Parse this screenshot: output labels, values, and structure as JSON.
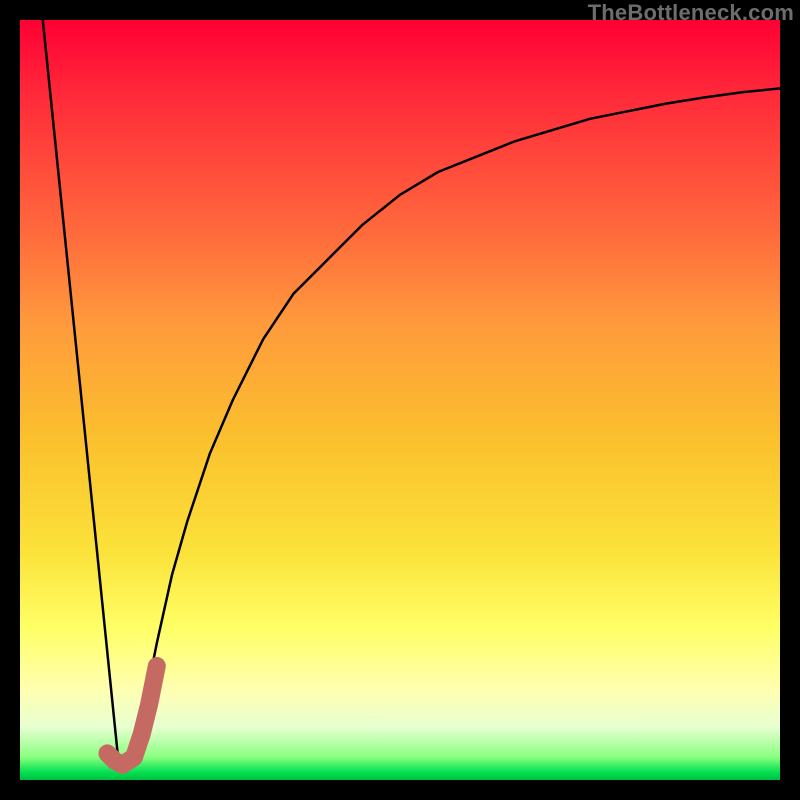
{
  "watermark": "TheBottleneck.com",
  "colors": {
    "frame": "#000000",
    "curve_stroke": "#000000",
    "marker_stroke": "#c56a63",
    "gradient_top": "#ff0033",
    "gradient_bottom": "#00c040"
  },
  "chart_data": {
    "type": "line",
    "title": "",
    "xlabel": "",
    "ylabel": "",
    "xlim": [
      0,
      100
    ],
    "ylim": [
      0,
      100
    ],
    "grid": false,
    "legend": false,
    "series": [
      {
        "name": "left-line",
        "kind": "line",
        "x": [
          3,
          13
        ],
        "y": [
          100,
          2
        ]
      },
      {
        "name": "right-curve",
        "kind": "line",
        "x": [
          15,
          16,
          18,
          20,
          22,
          25,
          28,
          32,
          36,
          40,
          45,
          50,
          55,
          60,
          65,
          70,
          75,
          80,
          85,
          90,
          95,
          100
        ],
        "y": [
          2,
          8,
          18,
          27,
          34,
          43,
          50,
          58,
          64,
          68,
          73,
          77,
          80,
          82,
          84,
          85.5,
          87,
          88,
          89,
          89.8,
          90.5,
          91
        ]
      },
      {
        "name": "marker-j",
        "kind": "marker",
        "x": [
          11.5,
          12.5,
          13.5,
          15,
          16,
          17,
          18
        ],
        "y": [
          3.5,
          2.5,
          2,
          3,
          6,
          10,
          15
        ]
      }
    ]
  }
}
